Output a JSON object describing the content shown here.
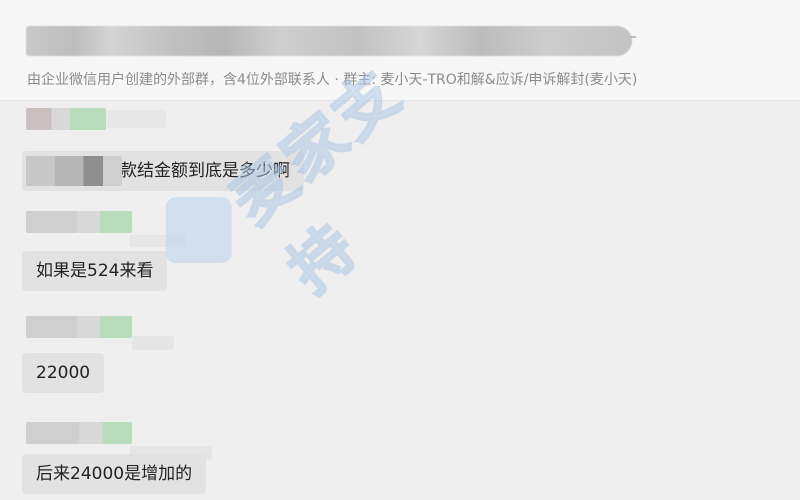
{
  "header": {
    "subtitle": "由企业微信用户创建的外部群，含4位外部联系人 · 群主: 麦小天-TRO和解&应诉/申诉解封(麦小天)"
  },
  "messages": [
    {
      "text": "款结金额到底是多少啊"
    },
    {
      "text": "如果是524来看"
    },
    {
      "text": "22000"
    },
    {
      "text": "后来24000是增加的"
    }
  ],
  "watermark": {
    "text": "麦家支持",
    "color": "#bcd3ea"
  },
  "colors": {
    "background": "#efefef",
    "bubble": "#e2e2e2",
    "name_blur_green": "#b9dcbd"
  }
}
